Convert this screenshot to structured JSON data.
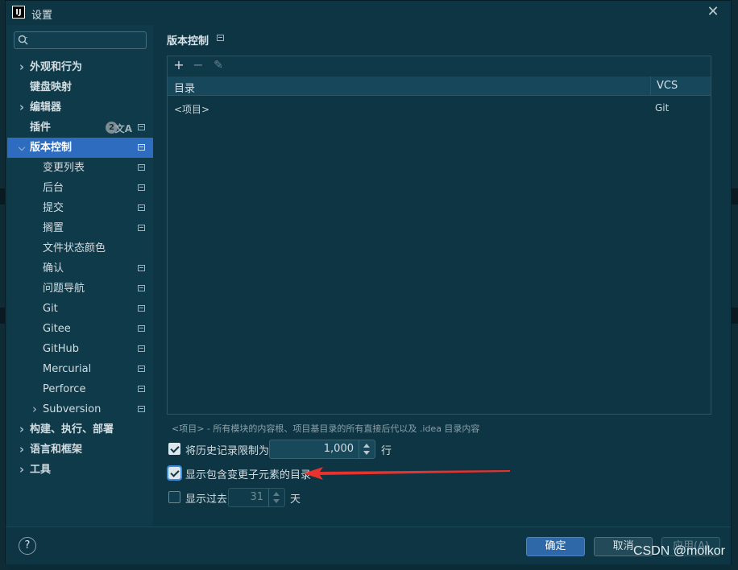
{
  "window": {
    "title": "设置",
    "logo_text": "IJ"
  },
  "search": {
    "placeholder": ""
  },
  "sidebar": {
    "items": [
      {
        "label": "外观和行为",
        "level": 0,
        "expandable": true,
        "expanded": false,
        "bold": true
      },
      {
        "label": "键盘映射",
        "level": 0,
        "expandable": false,
        "bold": true
      },
      {
        "label": "编辑器",
        "level": 0,
        "expandable": true,
        "expanded": false,
        "bold": true
      },
      {
        "label": "插件",
        "level": 0,
        "expandable": false,
        "bold": true,
        "badge": "2",
        "translate_icon": "文A",
        "mark": true
      },
      {
        "label": "版本控制",
        "level": 0,
        "expandable": true,
        "expanded": true,
        "bold": true,
        "selected": true,
        "mark": true
      },
      {
        "label": "变更列表",
        "level": 1,
        "mark": true
      },
      {
        "label": "后台",
        "level": 1,
        "mark": true
      },
      {
        "label": "提交",
        "level": 1,
        "mark": true
      },
      {
        "label": "搁置",
        "level": 1,
        "mark": true
      },
      {
        "label": "文件状态颜色",
        "level": 1,
        "mark": false
      },
      {
        "label": "确认",
        "level": 1,
        "mark": true
      },
      {
        "label": "问题导航",
        "level": 1,
        "mark": true
      },
      {
        "label": "Git",
        "level": 1,
        "mark": true
      },
      {
        "label": "Gitee",
        "level": 1,
        "mark": true
      },
      {
        "label": "GitHub",
        "level": 1,
        "mark": true
      },
      {
        "label": "Mercurial",
        "level": 1,
        "mark": true
      },
      {
        "label": "Perforce",
        "level": 1,
        "mark": true
      },
      {
        "label": "Subversion",
        "level": 1,
        "expandable": true,
        "expanded": false,
        "mark": true
      },
      {
        "label": "构建、执行、部署",
        "level": 0,
        "expandable": true,
        "expanded": false,
        "bold": true
      },
      {
        "label": "语言和框架",
        "level": 0,
        "expandable": true,
        "expanded": false,
        "bold": true
      },
      {
        "label": "工具",
        "level": 0,
        "expandable": true,
        "expanded": false,
        "bold": true
      }
    ]
  },
  "main": {
    "title": "版本控制",
    "table": {
      "toolbar": {
        "add": "+",
        "remove": "−",
        "edit": "✎"
      },
      "columns": [
        "目录",
        "VCS"
      ],
      "rows": [
        {
          "directory": "<项目>",
          "vcs": "Git"
        }
      ]
    },
    "hint": "<项目> - 所有模块的内容根、项目基目录的所有直接后代以及 .idea 目录内容",
    "options": {
      "history_limit": {
        "label": "将历史记录限制为:",
        "checked": true,
        "value": "1,000",
        "unit": "行"
      },
      "show_dirs": {
        "label": "显示包含变更子元素的目录",
        "checked": true
      },
      "show_past": {
        "label": "显示过去",
        "checked": false,
        "value": "31",
        "unit": "天"
      }
    }
  },
  "footer": {
    "help": "?",
    "ok": "确定",
    "cancel": "取消",
    "apply": "应用(A)"
  },
  "watermark": "CSDN @molkor",
  "colors": {
    "accent": "#2e6cc0",
    "annotation_arrow": "#e8322e",
    "background": "#0e3543"
  }
}
